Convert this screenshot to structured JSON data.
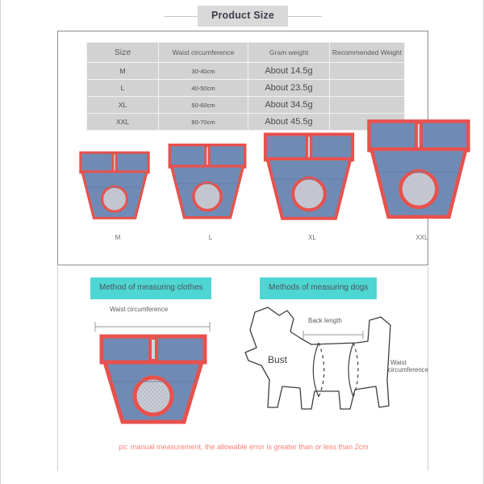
{
  "header": {
    "title": "Product Size"
  },
  "size_table": {
    "columns": [
      "Size",
      "Waist circumference",
      "Gram weight",
      "Recommended Weight"
    ],
    "rows": [
      {
        "size": "M",
        "waist": "30-40cm",
        "gram": "About 14.5g",
        "recommended": ""
      },
      {
        "size": "L",
        "waist": "40-50cm",
        "gram": "About 23.5g",
        "recommended": ""
      },
      {
        "size": "XL",
        "waist": "50-60cm",
        "gram": "About 34.5g",
        "recommended": ""
      },
      {
        "size": "XXL",
        "waist": "60-70cm",
        "gram": "About 45.5g",
        "recommended": ""
      }
    ]
  },
  "products": {
    "items": [
      {
        "label": "M",
        "icon": "dog-diaper-icon"
      },
      {
        "label": "L",
        "icon": "dog-diaper-icon"
      },
      {
        "label": "XL",
        "icon": "dog-diaper-icon"
      },
      {
        "label": "XXL",
        "icon": "dog-diaper-icon"
      }
    ]
  },
  "measuring": {
    "clothes_tag": "Method of measuring clothes",
    "dogs_tag": "Methods of measuring dogs",
    "clothes_label": "Waist circumference",
    "dog_back_length": "Back length",
    "dog_bust": "Bust",
    "dog_waist_line1": "Waist",
    "dog_waist_line2": "circumference"
  },
  "footer": {
    "note": "ps: manual measurement, the allowable error is greater than or less than 2cm"
  },
  "colors": {
    "title_box": "#d9d9d9",
    "table_bg": "#d2d2d2",
    "tag_teal": "#4ed6d2",
    "denim": "#6f8bb5",
    "trim_red": "#e8514d",
    "note_red": "#fb8179"
  }
}
